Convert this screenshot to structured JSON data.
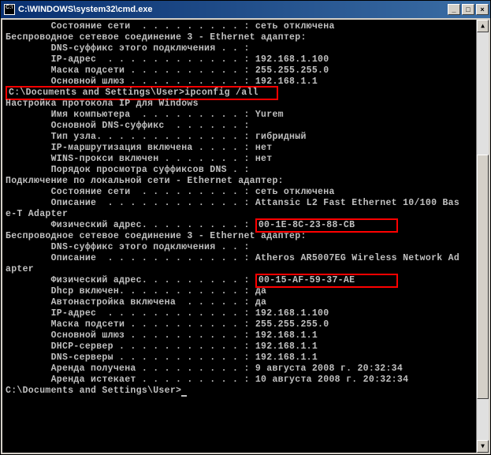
{
  "window": {
    "title": "C:\\WINDOWS\\system32\\cmd.exe"
  },
  "lines": {
    "l0": "        Состояние сети  . . . . . . . . . : сеть отключена",
    "l1": "",
    "l2": "Беспроводное сетевое соединение 3 - Ethernet адаптер:",
    "l3": "",
    "l4": "        DNS-суффикс этого подключения . . :",
    "l5": "        IP-адрес  . . . . . . . . . . . . : 192.168.1.100",
    "l6": "        Маска подсети . . . . . . . . . . : 255.255.255.0",
    "l7": "        Основной шлюз . . . . . . . . . . : 192.168.1.1",
    "l8": "",
    "prompt1_prefix": "C:\\Documents and Settings\\User>",
    "prompt1_cmd": "ipconfig /all",
    "l10": "",
    "l11": "Настройка протокола IP для Windows",
    "l12": "",
    "l13": "        Имя компьютера  . . . . . . . . . : Yurem",
    "l14": "        Основной DNS-суффикс  . . . . . . :",
    "l15": "        Тип узла. . . . . . . . . . . . . : гибридный",
    "l16": "        IP-маршрутизация включена . . . . : нет",
    "l17": "        WINS-прокси включен . . . . . . . : нет",
    "l18": "        Порядок просмотра суффиксов DNS . :",
    "l19": "",
    "l20": "Подключение по локальной сети - Ethernet адаптер:",
    "l21": "",
    "l22": "        Состояние сети  . . . . . . . . . : сеть отключена",
    "l23": "        Описание  . . . . . . . . . . . . : Attansic L2 Fast Ethernet 10/100 Bas",
    "l24": "e-T Adapter",
    "mac1_prefix": "        Физический адрес. . . . . . . . . : ",
    "mac1_val": "00-1E-8C-23-88-CB",
    "l26": "",
    "l27": "Беспроводное сетевое соединение 3 - Ethernet адаптер:",
    "l28": "",
    "l29": "        DNS-суффикс этого подключения . . :",
    "l30": "        Описание  . . . . . . . . . . . . : Atheros AR5007EG Wireless Network Ad",
    "l31": "apter",
    "mac2_prefix": "        Физический адрес. . . . . . . . . : ",
    "mac2_val": "00-15-AF-59-37-AE",
    "l33": "        Dhcp включен. . . . . . . . . . . : да",
    "l34": "        Автонастройка включена  . . . . . : да",
    "l35": "        IP-адрес  . . . . . . . . . . . . : 192.168.1.100",
    "l36": "        Маска подсети . . . . . . . . . . : 255.255.255.0",
    "l37": "        Основной шлюз . . . . . . . . . . : 192.168.1.1",
    "l38": "        DHCP-сервер . . . . . . . . . . . : 192.168.1.1",
    "l39": "        DNS-серверы . . . . . . . . . . . : 192.168.1.1",
    "l40": "",
    "l41": "        Аренда получена . . . . . . . . . : 9 августа 2008 г. 20:32:34",
    "l42": "        Аренда истекает . . . . . . . . . : 10 августа 2008 г. 20:32:34",
    "l43": "",
    "prompt2": "C:\\Documents and Settings\\User>"
  }
}
